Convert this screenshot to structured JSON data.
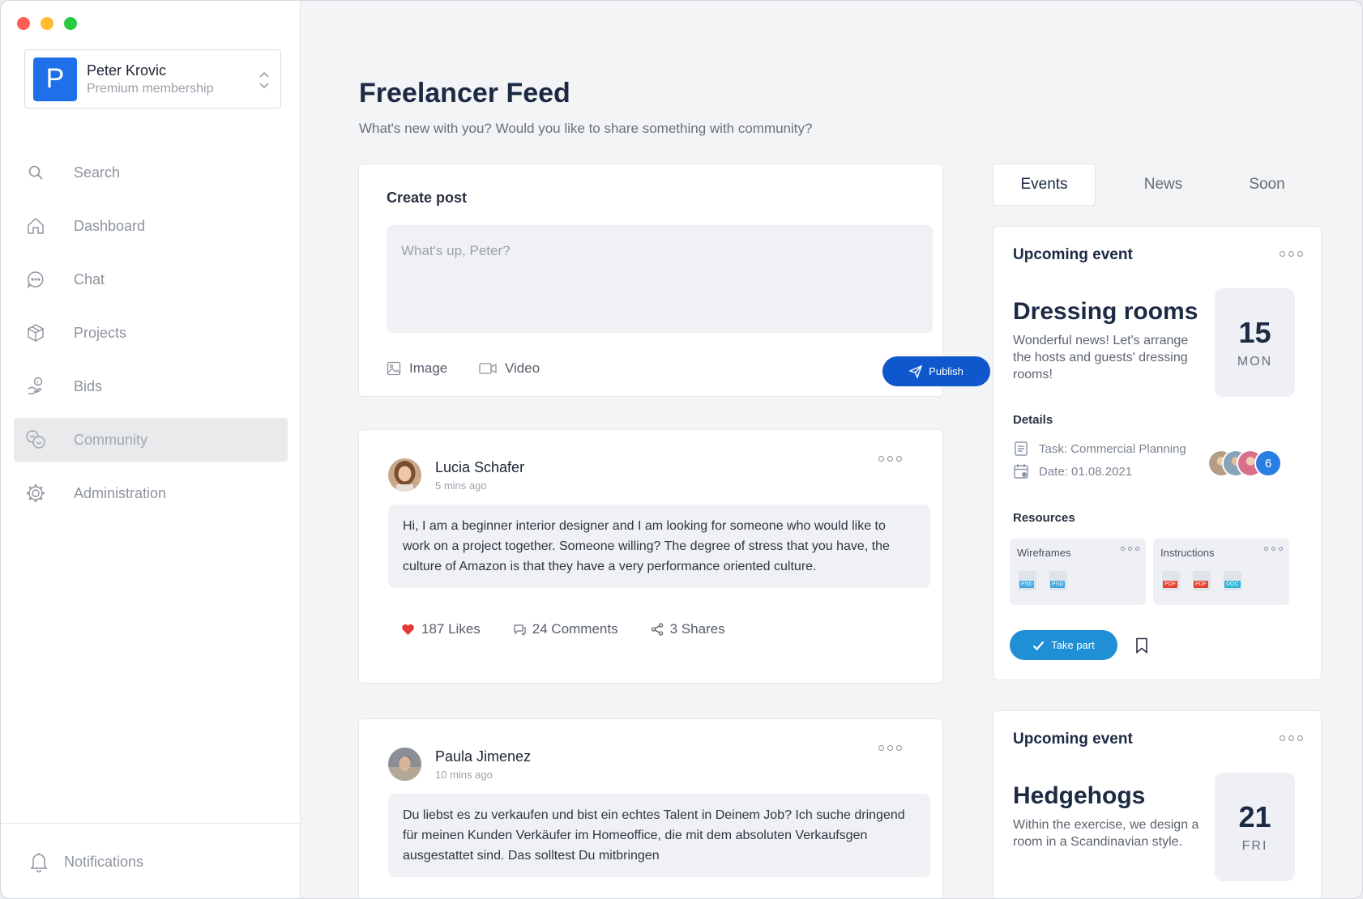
{
  "sidebar": {
    "profile": {
      "initial": "P",
      "name": "Peter Krovic",
      "membership": "Premium membership"
    },
    "items": [
      {
        "label": "Search",
        "icon": "search-icon"
      },
      {
        "label": "Dashboard",
        "icon": "home-icon"
      },
      {
        "label": "Chat",
        "icon": "chat-bubble-icon"
      },
      {
        "label": "Projects",
        "icon": "box-icon"
      },
      {
        "label": "Bids",
        "icon": "hand-coin-icon"
      },
      {
        "label": "Community",
        "icon": "community-chat-icon",
        "active": true
      },
      {
        "label": "Administration",
        "icon": "gear-icon"
      }
    ],
    "notifications": {
      "label": "Notifications",
      "icon": "bell-icon"
    }
  },
  "header": {
    "title": "Freelancer Feed",
    "subtitle": "What's new with you? Would you like to share something with community?"
  },
  "create_post": {
    "title": "Create post",
    "placeholder": "What's up, Peter?",
    "image_label": "Image",
    "video_label": "Video",
    "publish_label": "Publish"
  },
  "posts": [
    {
      "author": "Lucia Schafer",
      "time": "5 mins ago",
      "body": "Hi, I am a beginner interior designer and I am looking for someone who would like to work on a project together. Someone willing? The degree of stress that you have, the culture of Amazon is that they have a very performance oriented culture.",
      "likes": "187 Likes",
      "comments": "24 Comments",
      "shares": "3 Shares"
    },
    {
      "author": "Paula Jimenez",
      "time": "10 mins ago",
      "body": "Du liebst es zu verkaufen und bist ein echtes Talent in Deinem Job? Ich suche dringend für meinen Kunden Verkäufer im Homeoffice, die mit dem absoluten Verkaufsgen ausgestattet sind. Das solltest Du mitbringen"
    }
  ],
  "tabs": [
    {
      "label": "Events",
      "active": true
    },
    {
      "label": "News"
    },
    {
      "label": "Soon"
    }
  ],
  "events": [
    {
      "heading": "Upcoming event",
      "title": "Dressing rooms",
      "description": "Wonderful news! Let's arrange the hosts and guests' dressing rooms!",
      "day": "15",
      "weekday": "MON",
      "details_label": "Details",
      "task": "Task: Commercial Planning",
      "date": "Date: 01.08.2021",
      "participants_more": "6",
      "resources_label": "Resources",
      "resources": [
        {
          "name": "Wireframes",
          "files": [
            "PSD",
            "PSD"
          ]
        },
        {
          "name": "Instructions",
          "files": [
            "PDF",
            "PDF",
            "DOC"
          ]
        }
      ],
      "take_part_label": "Take part"
    },
    {
      "heading": "Upcoming event",
      "title": "Hedgehogs",
      "description": "Within the exercise, we design a room in a  Scandinavian style.",
      "day": "21",
      "weekday": "FRI"
    }
  ],
  "colors": {
    "accent": "#0f57cc",
    "take_part": "#1f8fd6",
    "avatar_bg": "#1f6feb",
    "like": "#e53935",
    "psd": "#3fa9e0",
    "pdf": "#e0442f",
    "doc": "#2fb4d6"
  }
}
